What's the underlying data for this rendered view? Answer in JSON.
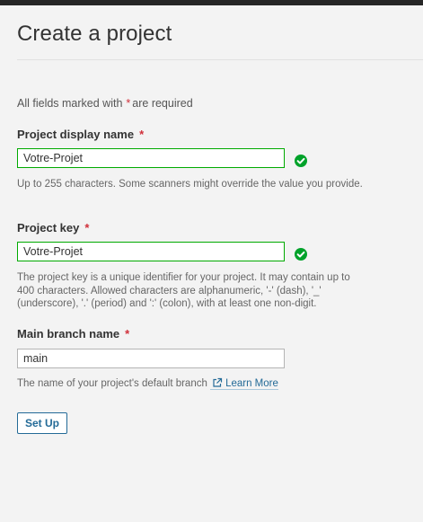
{
  "page": {
    "title": "Create a project",
    "required_note_before": "All fields marked with",
    "required_star": "*",
    "required_note_after": "are required"
  },
  "fields": {
    "display_name": {
      "label": "Project display name",
      "value": "Votre-Projet",
      "help": "Up to 255 characters. Some scanners might override the value you provide.",
      "status": "valid"
    },
    "project_key": {
      "label": "Project key",
      "value": "Votre-Projet",
      "help": "The project key is a unique identifier for your project. It may contain up to 400 characters. Allowed characters are alphanumeric, '-' (dash), '_' (underscore), '.' (period) and ':' (colon), with at least one non-digit.",
      "status": "valid"
    },
    "main_branch": {
      "label": "Main branch name",
      "value": "main",
      "help": "The name of your project's default branch",
      "link_text": "Learn More"
    }
  },
  "actions": {
    "setup_label": "Set Up"
  },
  "icons": {
    "valid": "check-circle-icon",
    "external_link": "external-link-icon"
  },
  "colors": {
    "valid_green": "#00aa00",
    "check_fill": "#00a22a",
    "required_red": "#d02f3a",
    "link_blue": "#236a97",
    "topbar": "#262626"
  }
}
